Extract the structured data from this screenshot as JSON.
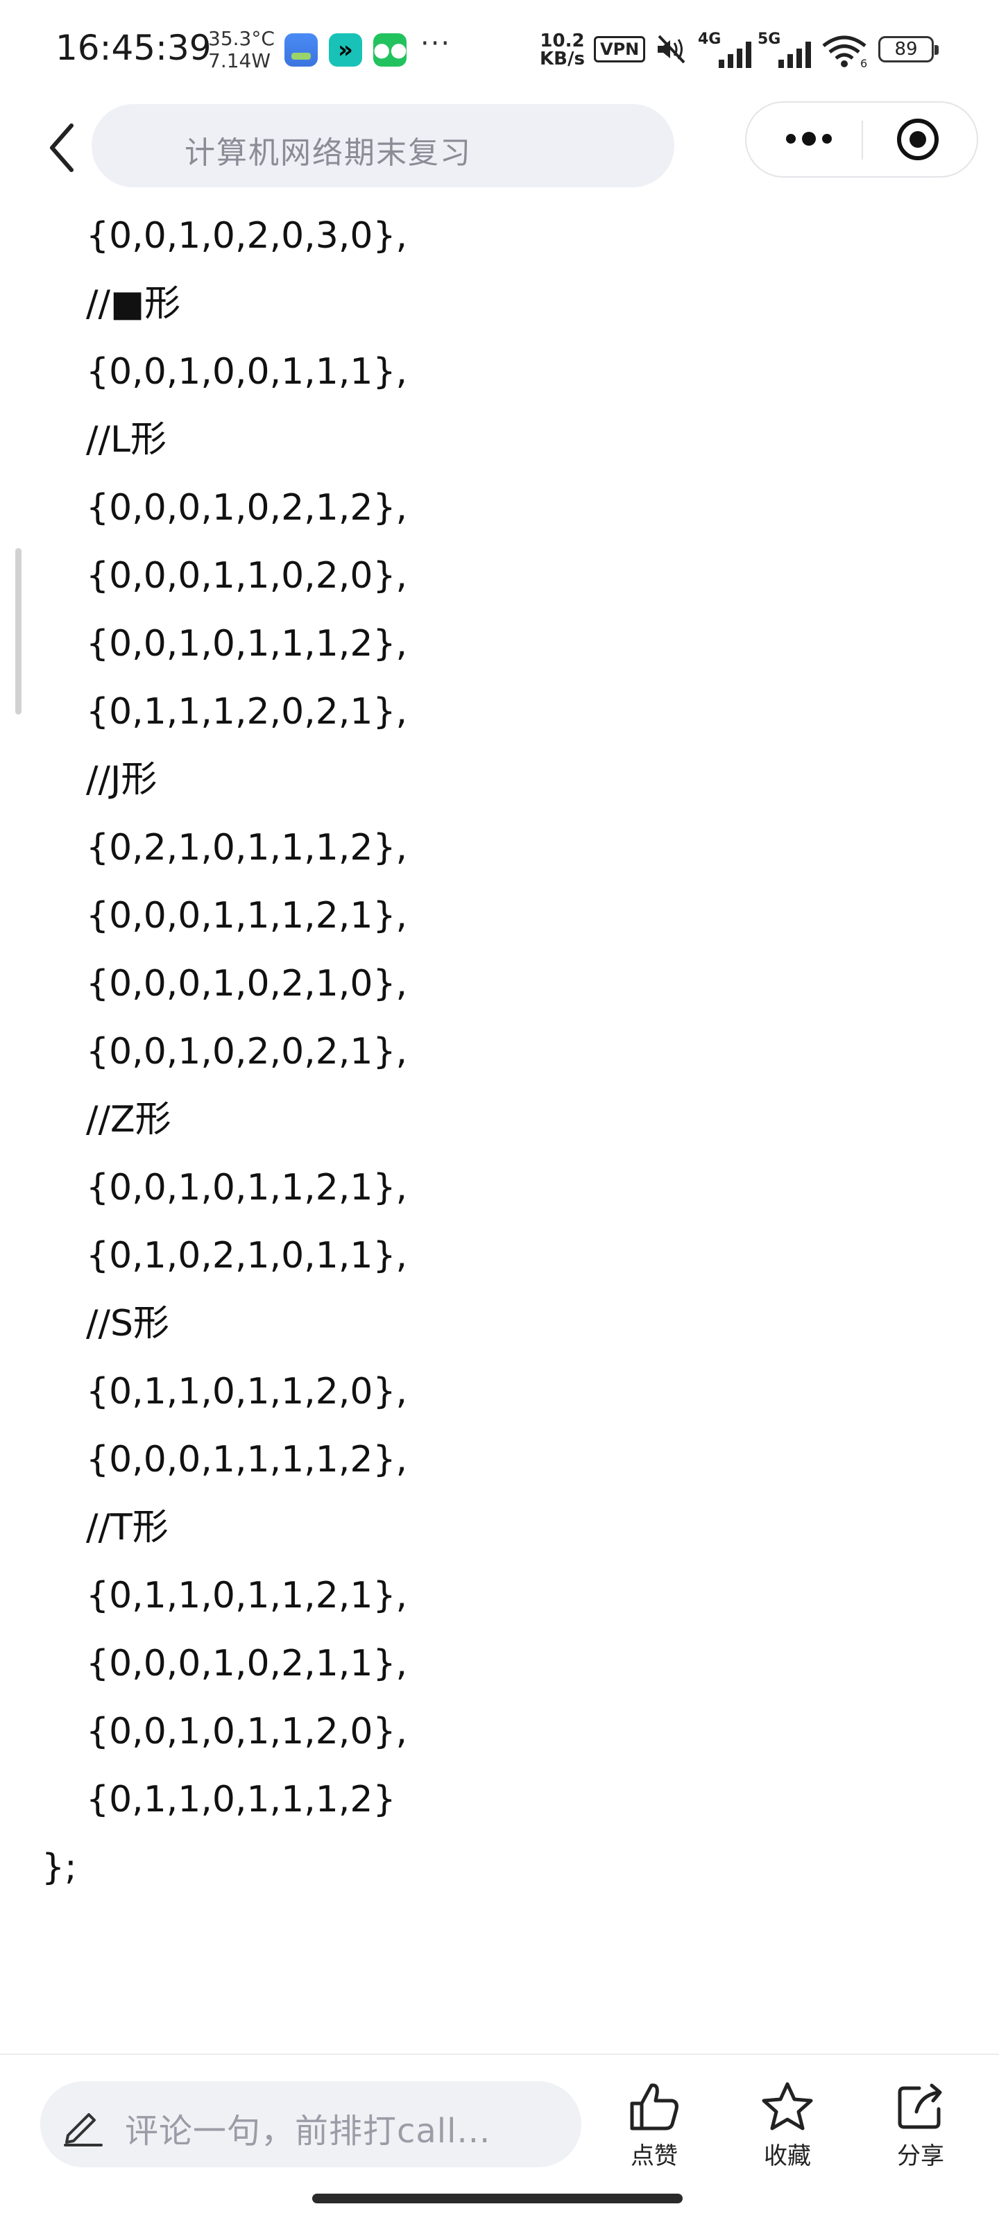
{
  "status_bar": {
    "time": "16:45:39",
    "temperature": "35.3°C",
    "power": "7.14W",
    "more": "···",
    "speed_value": "10.2",
    "speed_unit": "KB/s",
    "vpn": "VPN",
    "net_4g": "4G",
    "net_5g": "5G",
    "battery": "89",
    "apps": [
      "weather-app-icon",
      "fast-forward-app-icon",
      "wechat-app-icon"
    ]
  },
  "header": {
    "search_placeholder": "计算机网络期末复习",
    "icons": [
      "back-icon",
      "more-icon",
      "close-target-icon"
    ]
  },
  "content": {
    "code_lines": [
      "{0,0,1,0,2,0,3,0},",
      "//■形",
      "{0,0,1,0,0,1,1,1},",
      "//L形",
      "{0,0,0,1,0,2,1,2},",
      "{0,0,0,1,1,0,2,0},",
      "{0,0,1,0,1,1,1,2},",
      "{0,1,1,1,2,0,2,1},",
      "//J形",
      "{0,2,1,0,1,1,1,2},",
      "{0,0,0,1,1,1,2,1},",
      "{0,0,0,1,0,2,1,0},",
      "{0,0,1,0,2,0,2,1},",
      "//Z形",
      "{0,0,1,0,1,1,2,1},",
      "{0,1,0,2,1,0,1,1},",
      "//S形",
      "{0,1,1,0,1,1,2,0},",
      "{0,0,0,1,1,1,1,2},",
      "//T形",
      "{0,1,1,0,1,1,2,1},",
      "{0,0,0,1,0,2,1,1},",
      "{0,0,1,0,1,1,2,0},",
      "{0,1,1,0,1,1,1,2}"
    ],
    "closing": "};"
  },
  "bottom_bar": {
    "comment_placeholder": "评论一句，前排打call...",
    "like_label": "点赞",
    "favorite_label": "收藏",
    "share_label": "分享"
  },
  "colors": {
    "search_bg": "#eff0f5",
    "placeholder_text": "#8a8c96",
    "text": "#111111"
  }
}
